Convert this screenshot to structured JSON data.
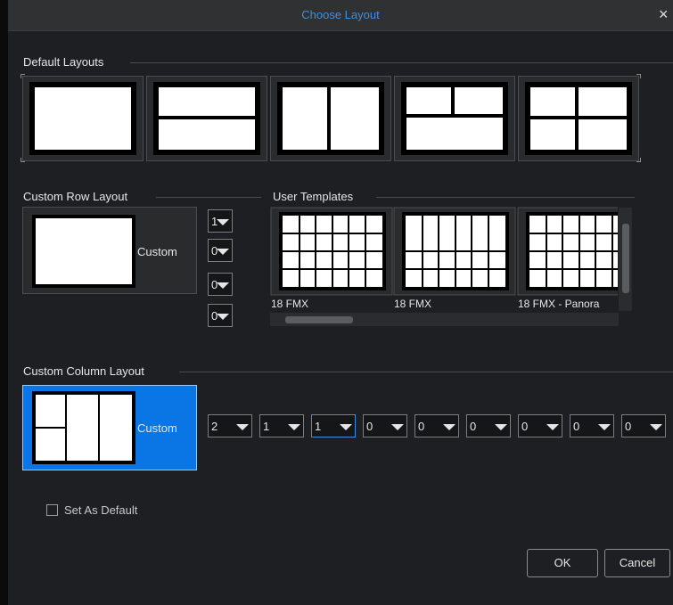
{
  "window": {
    "title": "Choose Layout",
    "close_icon": "×"
  },
  "sections": {
    "default_layouts": "Default Layouts",
    "custom_row_layout": "Custom Row Layout",
    "user_templates": "User Templates",
    "custom_column_layout": "Custom Column Layout"
  },
  "default_layout_names": [
    "single",
    "two-rows",
    "two-columns",
    "one-top-split-over-one",
    "grid-2x2"
  ],
  "custom_row": {
    "label": "Custom",
    "rows": [
      "1",
      "0",
      "0",
      "0"
    ]
  },
  "user_templates": {
    "items": [
      "18 FMX",
      "18 FMX",
      "18 FMX - Panora"
    ]
  },
  "custom_column": {
    "label": "Custom",
    "columns": [
      "2",
      "1",
      "1",
      "0",
      "0",
      "0",
      "0",
      "0",
      "0"
    ]
  },
  "set_as_default": {
    "label": "Set As Default",
    "checked": false
  },
  "buttons": {
    "ok": "OK",
    "cancel": "Cancel"
  },
  "colors": {
    "accent": "#3d8fe0",
    "selected_tile": "#0a76e6"
  }
}
